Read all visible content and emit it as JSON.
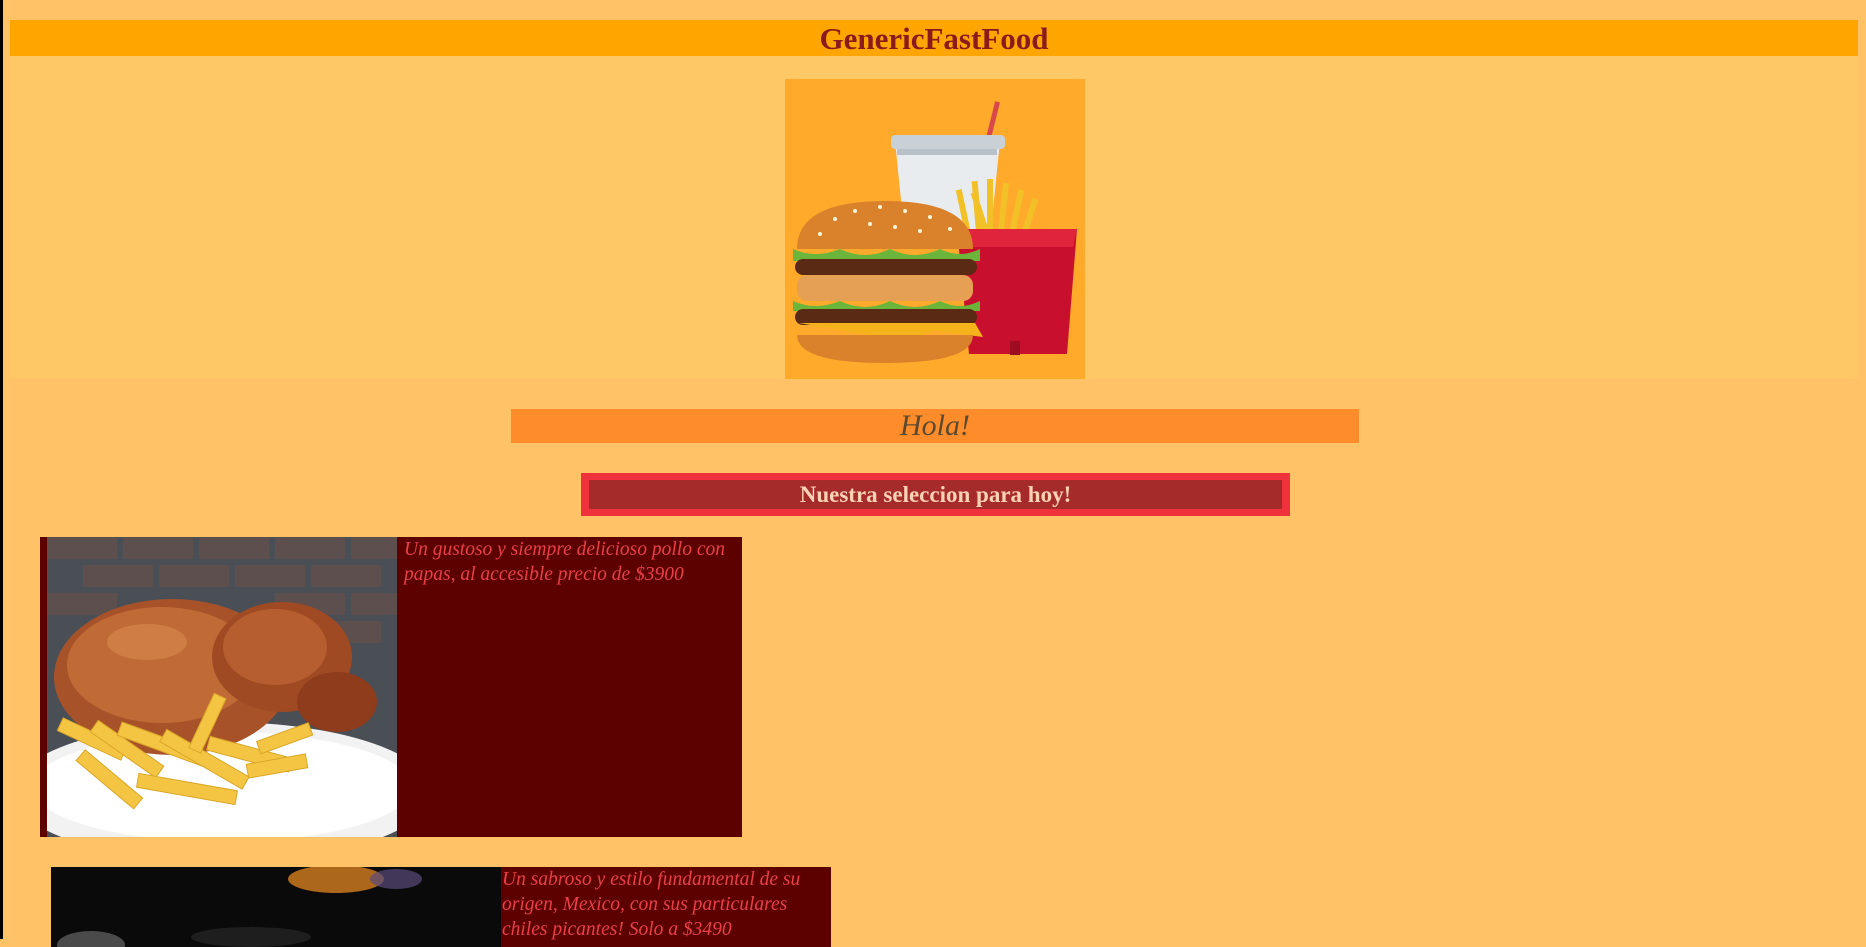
{
  "header": {
    "title": "GenericFastFood"
  },
  "hero": {
    "logo_icon": "burger-combo-icon"
  },
  "greeting": {
    "text": "Hola!"
  },
  "selection": {
    "heading": "Nuestra seleccion para hoy!"
  },
  "menu": {
    "items": [
      {
        "photo_icon": "roast-chicken-fries-photo",
        "description": "Un gustoso y siempre delicioso pollo con papas, al accesible precio de $3900"
      },
      {
        "photo_icon": "mexican-dish-photo",
        "description": "Un sabroso y estilo fundamental de su origen, Mexico, con sus particulares chiles picantes! Solo a $3490"
      }
    ]
  },
  "colors": {
    "page_background": "#ffc266",
    "header_bar": "#ffa500",
    "title_text": "#8b1a1a",
    "greeting_bar": "#ff8c2b",
    "banner_border": "#f0323c",
    "banner_fill": "#a52a2a",
    "card_background": "#5c0000",
    "card_text": "#e8404a"
  }
}
